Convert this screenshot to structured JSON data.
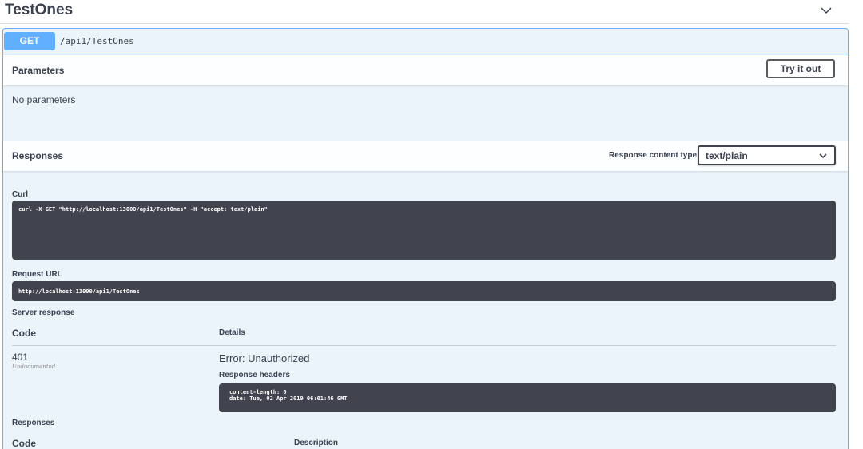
{
  "tag": {
    "title": "TestOnes"
  },
  "operation": {
    "method": "GET",
    "path": "/api1/TestOnes",
    "accent": "#61affe"
  },
  "parameters": {
    "title": "Parameters",
    "try_it_out": "Try it out",
    "empty_text": "No parameters"
  },
  "responses_header": {
    "title": "Responses",
    "content_type_label": "Response content type",
    "content_type_value": "text/plain"
  },
  "curl": {
    "label": "Curl",
    "command": "curl -X GET \"http://localhost:13000/api1/TestOnes\" -H \"accept: text/plain\""
  },
  "request_url": {
    "label": "Request URL",
    "value": "http://localhost:13000/api1/TestOnes"
  },
  "server_response": {
    "label": "Server response",
    "code_header": "Code",
    "details_header": "Details",
    "code": "401",
    "undocumented": "Undocumented",
    "error": "Error: Unauthorized",
    "headers_label": "Response headers",
    "headers_text": "content-length: 0\ndate: Tue, 02 Apr 2019 06:01:46 GMT"
  },
  "responses_footer": {
    "label": "Responses",
    "code_header": "Code",
    "description_header": "Description"
  },
  "icons": {
    "collapse": "chevron-down-icon",
    "select": "chevron-down-icon"
  }
}
